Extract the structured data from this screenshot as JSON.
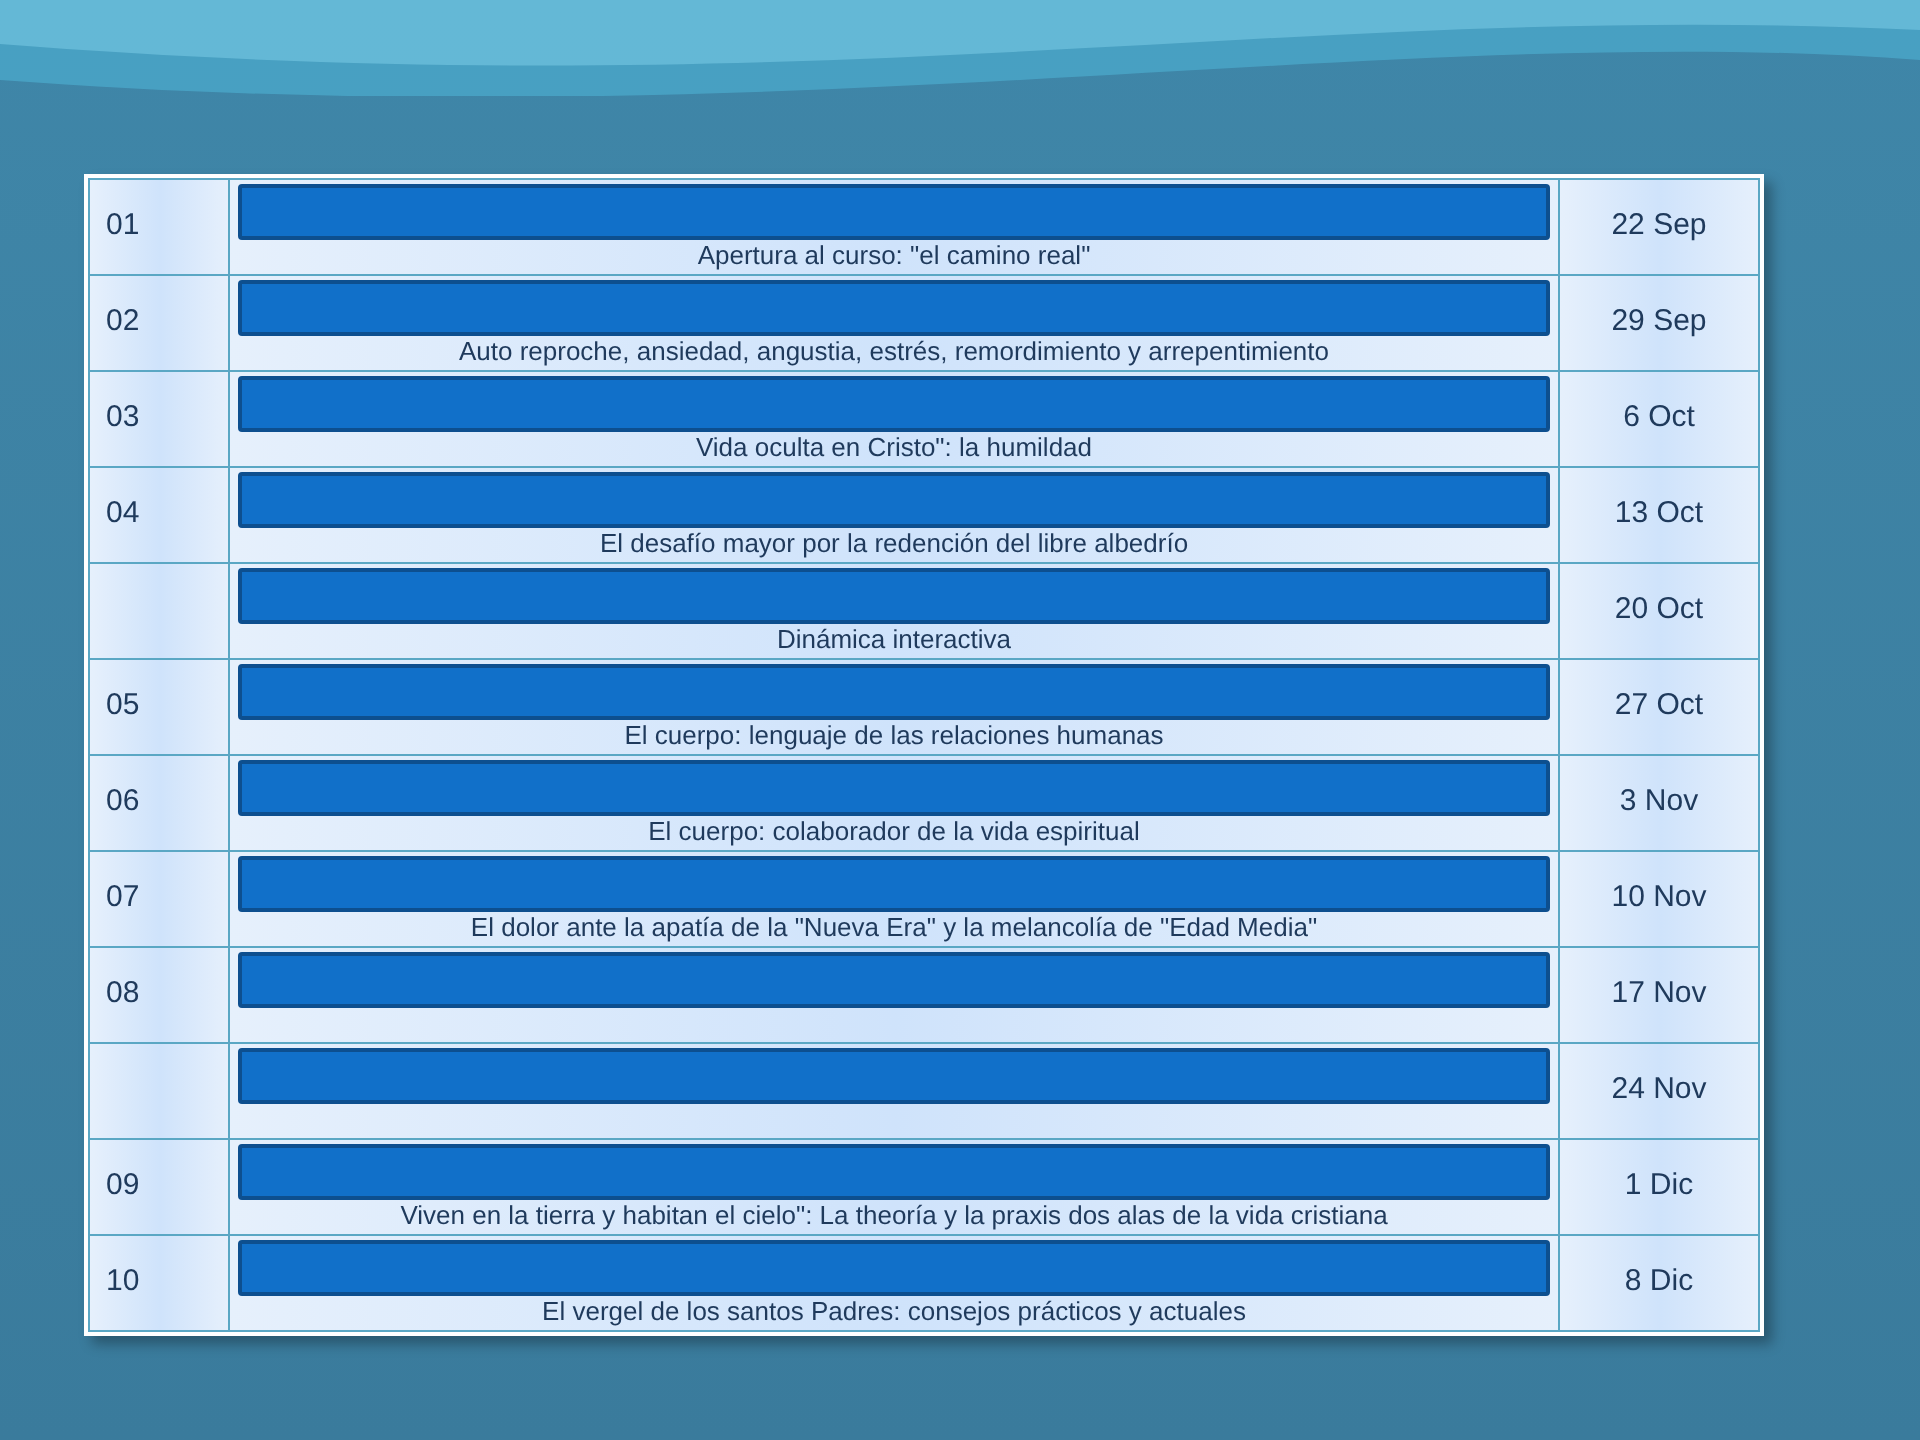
{
  "table": {
    "rows": [
      {
        "number": "01",
        "title": "Apertura al curso: \"el camino real\"",
        "date": "22 Sep"
      },
      {
        "number": "02",
        "title": "Auto reproche, ansiedad, angustia, estrés, remordimiento y arrepentimiento",
        "date": "29 Sep"
      },
      {
        "number": "03",
        "title": "Vida oculta en Cristo\": la humildad",
        "date": "6 Oct"
      },
      {
        "number": "04",
        "title": "El desafío mayor por la redención del libre albedrío",
        "date": "13 Oct"
      },
      {
        "title": "Dinámica interactiva",
        "date": "20 Oct"
      },
      {
        "number": "05",
        "title": "El cuerpo: lenguaje de las relaciones humanas",
        "date": "27 Oct"
      },
      {
        "number": "06",
        "title": "El cuerpo: colaborador de la vida espiritual",
        "date": "3 Nov"
      },
      {
        "number": "07",
        "title": "El dolor ante la apatía de la \"Nueva Era\" y la melancolía de \"Edad Media\"",
        "date": "10 Nov"
      },
      {
        "number": "08",
        "date": "17 Nov"
      },
      {
        "date": "24 Nov"
      },
      {
        "number": "09",
        "title": "Viven en la tierra y habitan el cielo\": La theoría y la praxis dos alas de la vida cristiana",
        "date": "1 Dic"
      },
      {
        "number": "10",
        "title": "El vergel de los santos Padres: consejos prácticos y actuales",
        "date": "8 Dic"
      }
    ]
  }
}
